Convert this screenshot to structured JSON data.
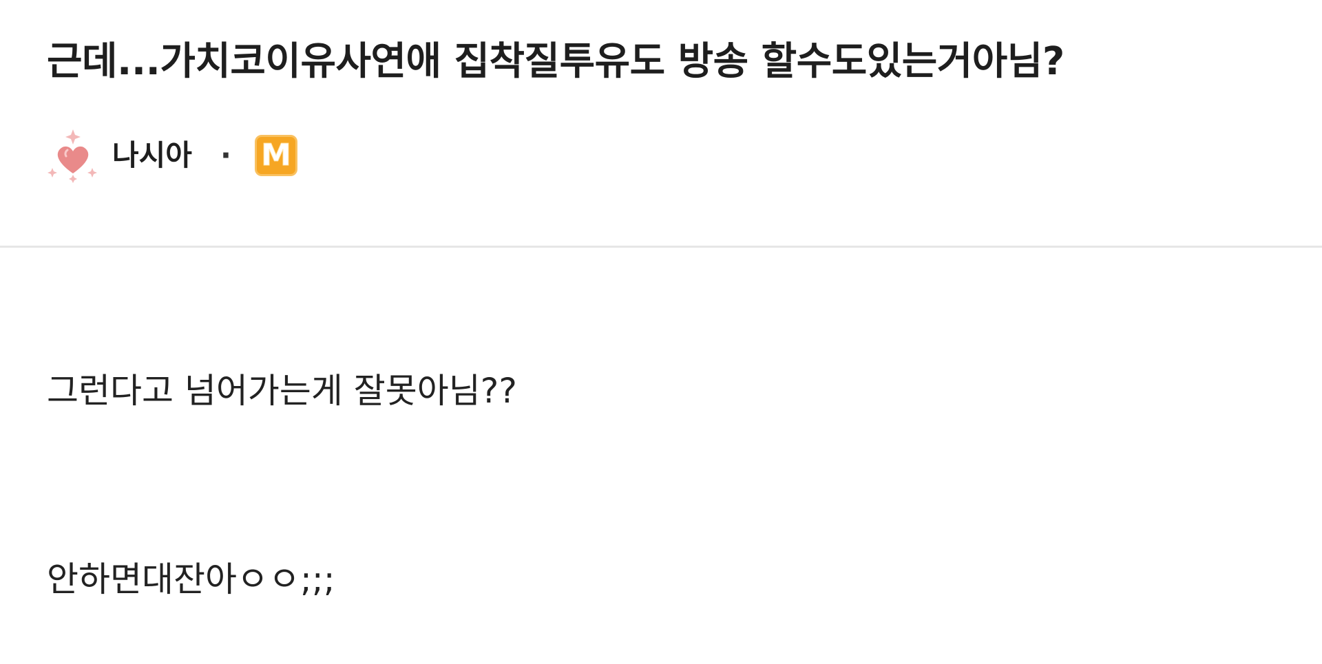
{
  "post": {
    "title": "근데...가치코이유사연애 집착질투유도 방송 할수도있는거아님?",
    "author": {
      "avatar_icon": "heart-sparkle-icon",
      "name": "나시아",
      "separator": "·",
      "level_badge": "M",
      "level_badge_color": "#f6a623"
    },
    "body": [
      "그런다고 넘어가는게 잘못아님??",
      "안하면대잔아ㅇㅇ;;;"
    ]
  }
}
